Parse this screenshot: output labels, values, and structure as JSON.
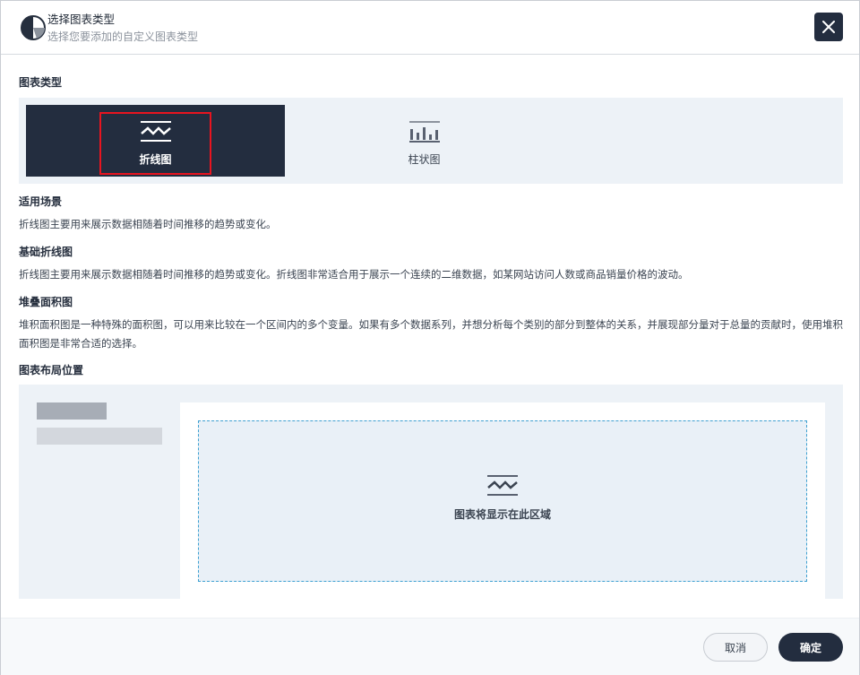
{
  "header": {
    "title": "选择图表类型",
    "subtitle": "选择您要添加的自定义图表类型",
    "close_icon": "close-icon"
  },
  "chart_types": {
    "section_title": "图表类型",
    "items": [
      {
        "label": "折线图",
        "icon": "line-chart-icon",
        "selected": true
      },
      {
        "label": "柱状图",
        "icon": "bar-chart-icon",
        "selected": false
      }
    ]
  },
  "scenarios": {
    "title": "适用场景",
    "text": "折线图主要用来展示数据相随着时间推移的趋势或变化。"
  },
  "basic_line": {
    "title": "基础折线图",
    "text": "折线图主要用来展示数据相随着时间推移的趋势或变化。折线图非常适合用于展示一个连续的二维数据，如某网站访问人数或商品销量价格的波动。"
  },
  "stacked_area": {
    "title": "堆叠面积图",
    "text": "堆积面积图是一种特殊的面积图，可以用来比较在一个区间内的多个变量。如果有多个数据系列，并想分析每个类别的部分到整体的关系，并展现部分量对于总量的贡献时，使用堆积面积图是非常合适的选择。"
  },
  "layout": {
    "title": "图表布局位置",
    "placeholder": "图表将显示在此区域",
    "icon": "line-chart-icon"
  },
  "footer": {
    "cancel_label": "取消",
    "ok_label": "确定"
  },
  "colors": {
    "primary": "#232d3f",
    "highlight": "#e8141f",
    "dashed_border": "#3da0d1"
  }
}
